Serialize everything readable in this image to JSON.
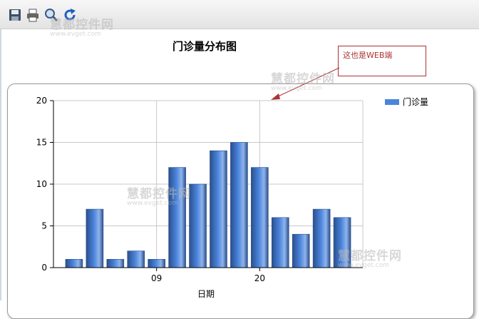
{
  "toolbar": {
    "buttons": [
      {
        "icon": "save-icon"
      },
      {
        "icon": "print-icon"
      },
      {
        "icon": "zoom-icon"
      },
      {
        "icon": "refresh-icon"
      }
    ]
  },
  "watermark": {
    "main": "慧都控件网",
    "sub": "www.evget.com"
  },
  "annotation": {
    "text": "这也是WEB端",
    "color": "#aa3333"
  },
  "colors": {
    "bar": "#4a84dc",
    "bar_dark": "#2a4f8c",
    "grid": "#c8c8c8"
  },
  "chart_data": {
    "type": "bar",
    "title": "门诊量分布图",
    "xlabel": "日期",
    "ylabel": "",
    "ylim": [
      0,
      20
    ],
    "yticks": [
      0,
      5,
      10,
      15,
      20
    ],
    "x": [
      4,
      5,
      6,
      7,
      8,
      9,
      10,
      11,
      12,
      13,
      14,
      15,
      16,
      17
    ],
    "xlim": [
      3,
      18
    ],
    "xticks": [
      {
        "value": 8,
        "label": "09"
      },
      {
        "value": 13,
        "label": "20"
      }
    ],
    "series": [
      {
        "name": "门诊量",
        "values": [
          1,
          7,
          1,
          2,
          1,
          12,
          10,
          14,
          15,
          12,
          6,
          4,
          7,
          6
        ]
      }
    ],
    "grid": true,
    "legend": "top-right"
  }
}
